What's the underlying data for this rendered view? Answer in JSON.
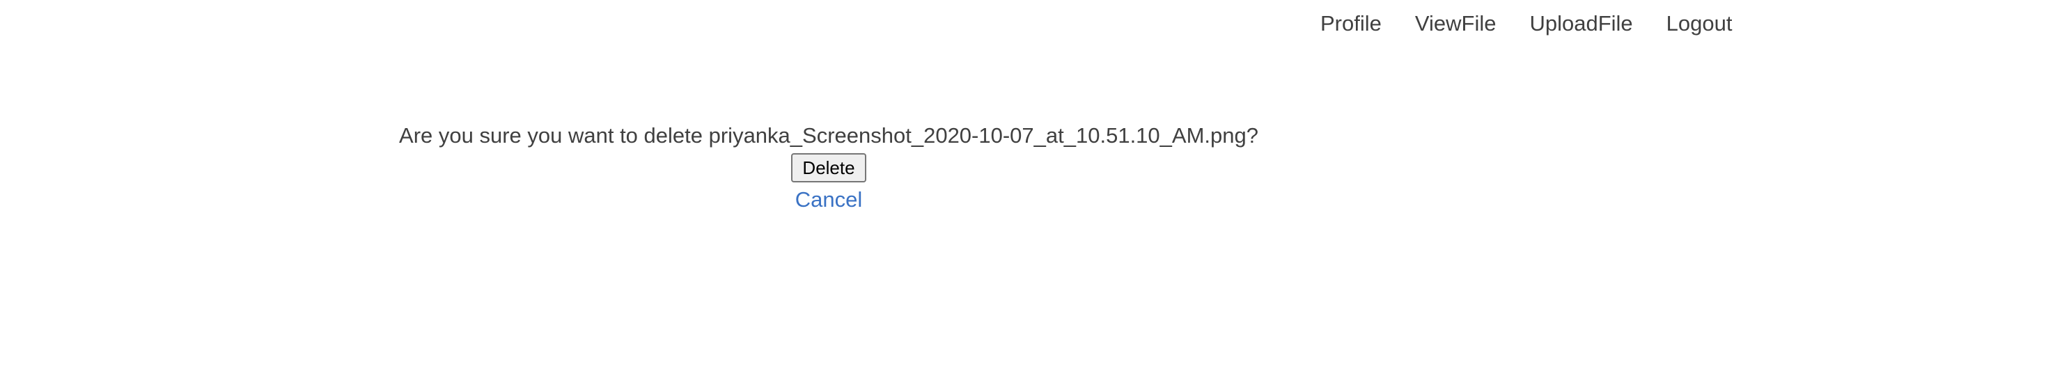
{
  "nav": {
    "items": [
      {
        "label": "Profile"
      },
      {
        "label": "ViewFile"
      },
      {
        "label": "UploadFile"
      },
      {
        "label": "Logout"
      }
    ]
  },
  "confirm": {
    "message": "Are you sure you want to delete priyanka_Screenshot_2020-10-07_at_10.51.10_AM.png?",
    "delete_label": "Delete",
    "cancel_label": "Cancel"
  },
  "colors": {
    "text": "#404040",
    "link": "#3a72c4",
    "button_bg": "#efefef",
    "button_border": "#767676"
  }
}
